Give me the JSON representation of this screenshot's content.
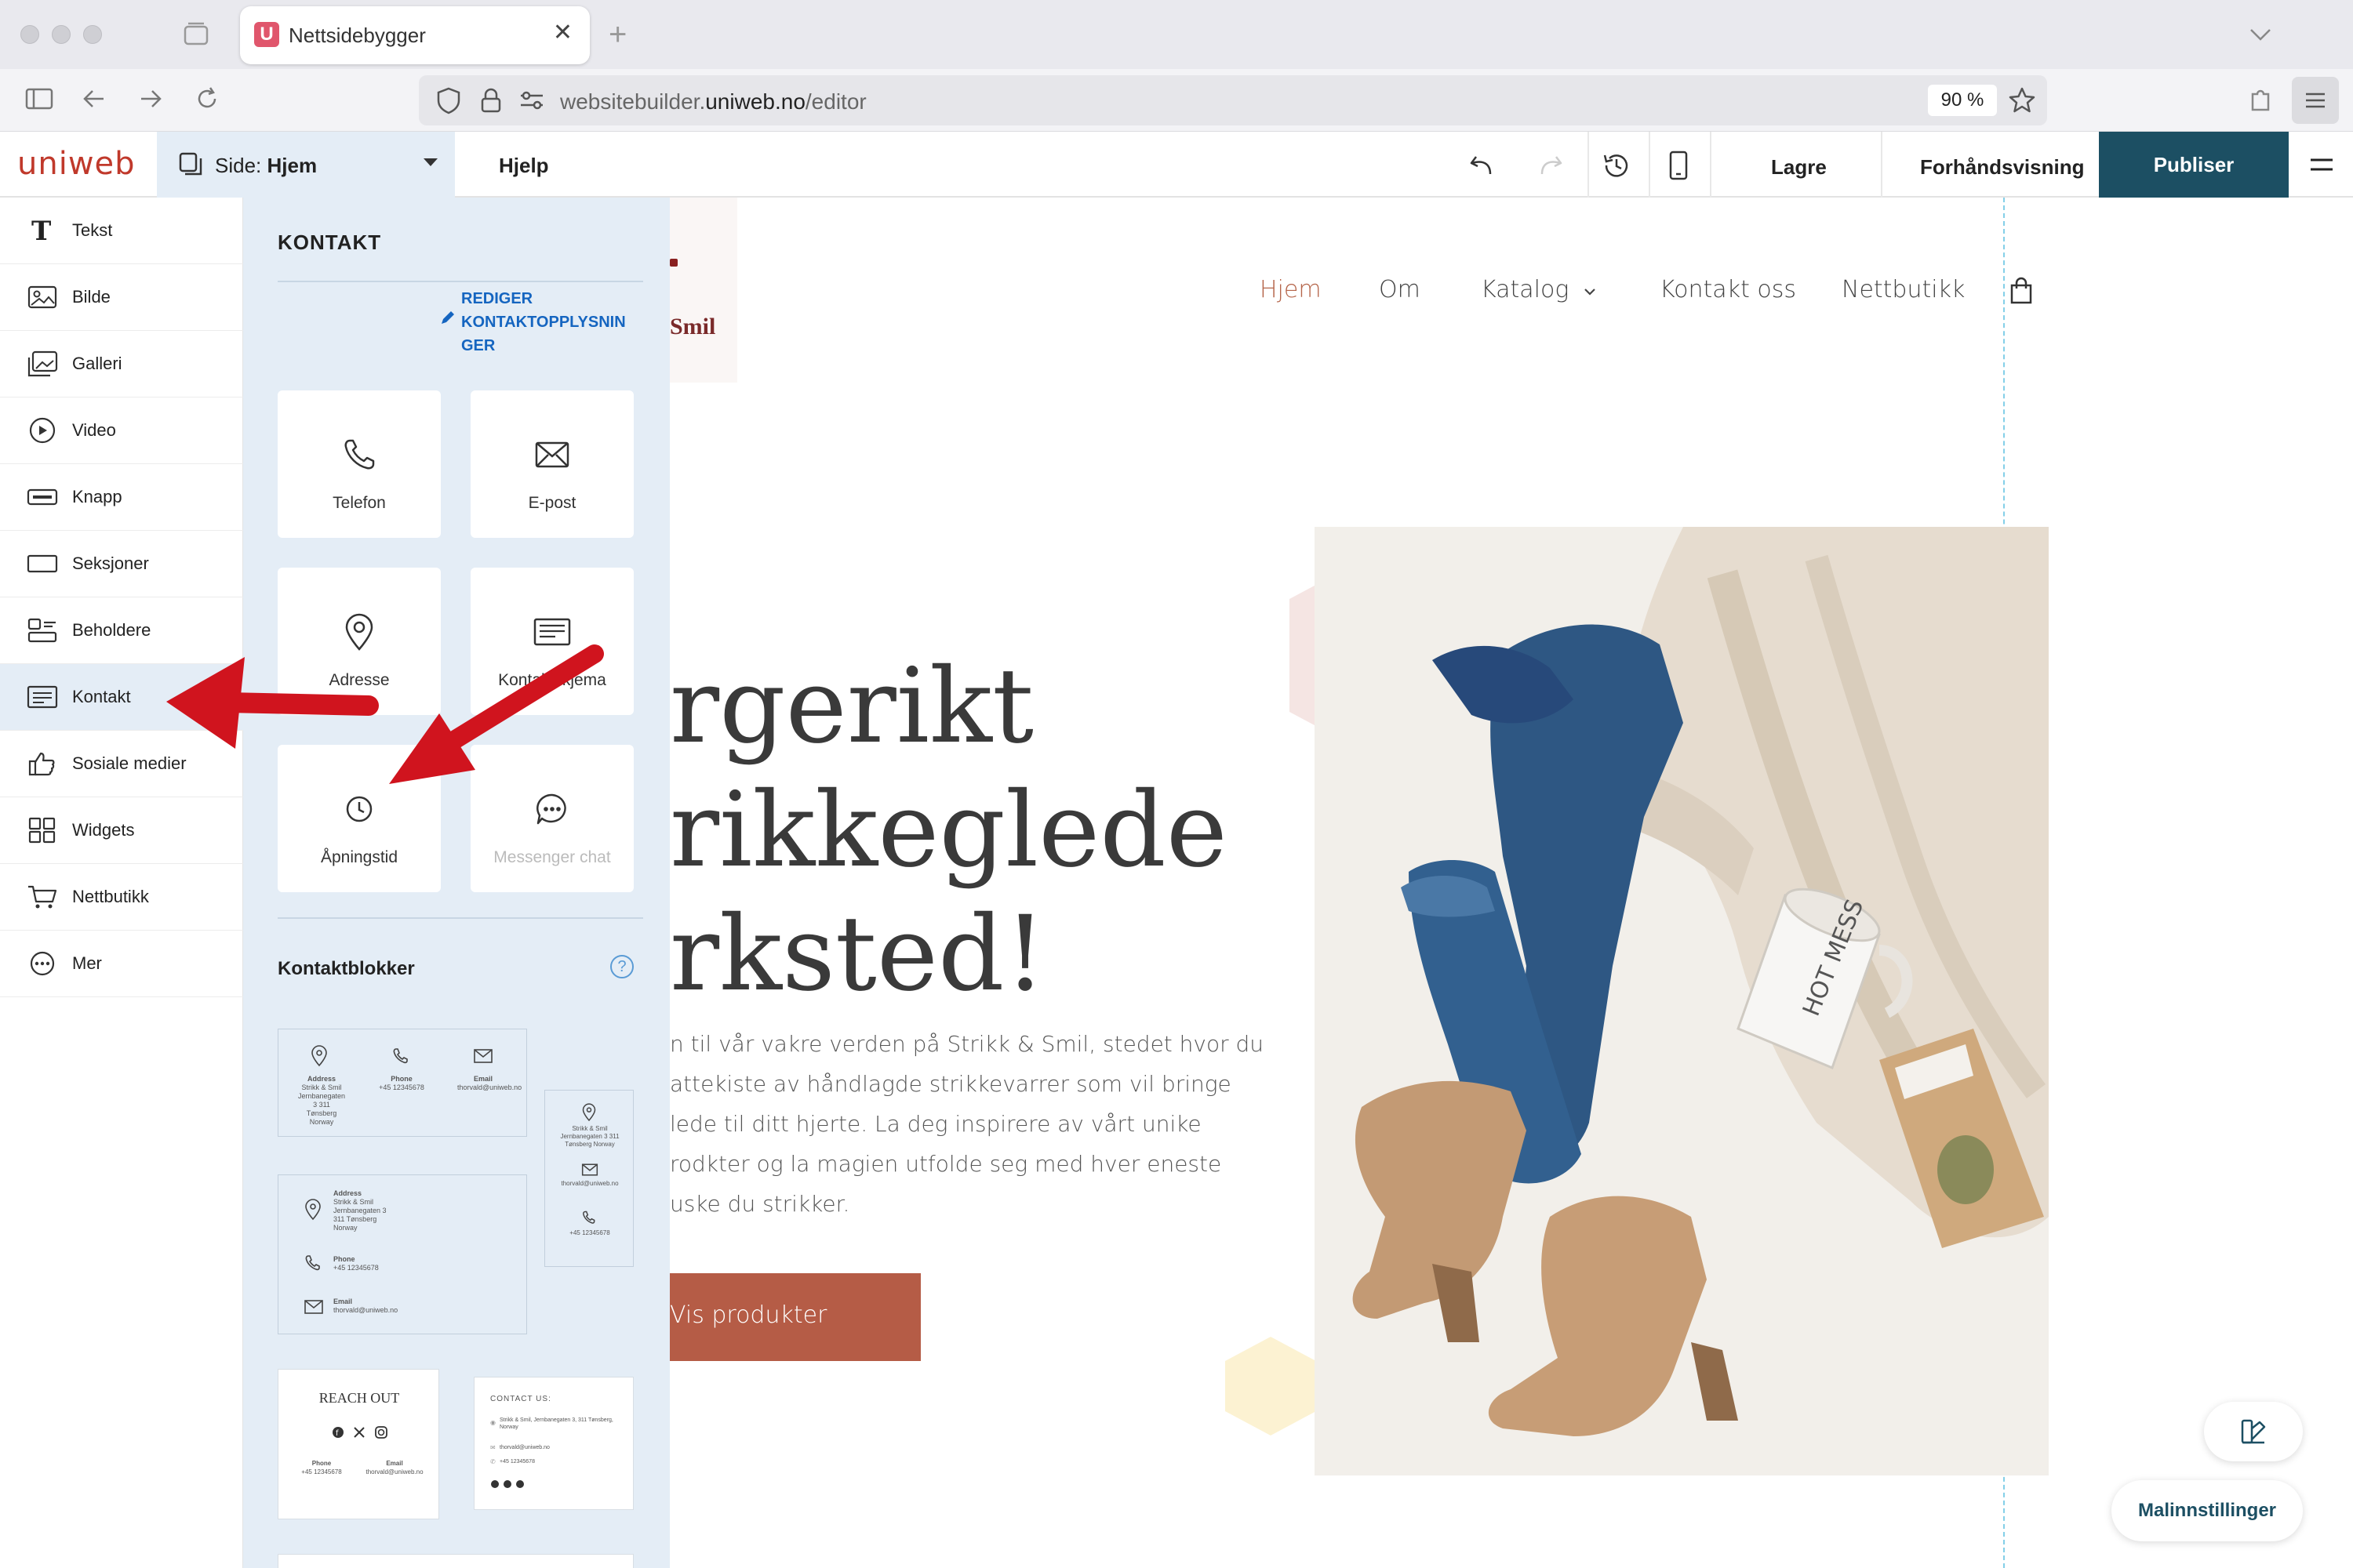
{
  "browser": {
    "tab_title": "Nettsidebygger",
    "tab_favicon": "U",
    "url_prefix": "websitebuilder.",
    "url_domain": "uniweb.no",
    "url_path": "/editor",
    "zoom": "90 %"
  },
  "toolbar": {
    "logo": "uniweb",
    "page_prefix": "Side: ",
    "page_name": "Hjem",
    "help": "Hjelp",
    "save": "Lagre",
    "preview": "Forhåndsvisning",
    "publish": "Publiser"
  },
  "sidebar": {
    "items": [
      {
        "label": "Tekst",
        "icon": "text-icon"
      },
      {
        "label": "Bilde",
        "icon": "image-icon"
      },
      {
        "label": "Galleri",
        "icon": "gallery-icon"
      },
      {
        "label": "Video",
        "icon": "video-icon"
      },
      {
        "label": "Knapp",
        "icon": "button-icon"
      },
      {
        "label": "Seksjoner",
        "icon": "sections-icon"
      },
      {
        "label": "Beholdere",
        "icon": "containers-icon"
      },
      {
        "label": "Kontakt",
        "icon": "contact-icon",
        "active": true
      },
      {
        "label": "Sosiale medier",
        "icon": "thumbs-up-icon"
      },
      {
        "label": "Widgets",
        "icon": "widgets-icon"
      },
      {
        "label": "Nettbutikk",
        "icon": "cart-icon"
      },
      {
        "label": "Mer",
        "icon": "more-icon"
      }
    ]
  },
  "panel": {
    "title": "KONTAKT",
    "edit_line1": "REDIGER",
    "edit_line2": "KONTAKTOPPLYSNIN",
    "edit_line3": "GER",
    "tiles": [
      {
        "label": "Telefon",
        "icon": "phone-icon"
      },
      {
        "label": "E-post",
        "icon": "email-icon"
      },
      {
        "label": "Adresse",
        "icon": "location-icon"
      },
      {
        "label": "Kontaktskjema",
        "icon": "form-icon"
      },
      {
        "label": "Åpningstid",
        "icon": "clock-icon"
      },
      {
        "label": "Messenger chat",
        "icon": "chat-icon",
        "disabled": true
      }
    ],
    "blocks_title": "Kontaktblokker",
    "blocks_help": "?",
    "block1": {
      "address_label": "Address",
      "address_text": "Strikk & Smil Jernbanegaten 3 311 Tønsberg Norway",
      "phone_label": "Phone",
      "phone_text": "+45 12345678",
      "email_label": "Email",
      "email_text": "thorvald@uniweb.no"
    },
    "block2": {
      "address_label": "Address",
      "address_line1": "Strikk & Smil",
      "address_line2": "Jernbanegaten 3",
      "address_line3": "311 Tønsberg",
      "address_line4": "Norway",
      "phone_label": "Phone",
      "phone_text": "+45 12345678",
      "email_label": "Email",
      "email_text": "thorvald@uniweb.no"
    },
    "block3": {
      "address_text": "Strikk & Smil Jernbanegaten 3 311 Tønsberg Norway",
      "email_text": "thorvald@uniweb.no",
      "phone_text": "+45 12345678"
    },
    "block4": {
      "title": "REACH OUT",
      "phone_label": "Phone",
      "phone_text": "+45 12345678",
      "email_label": "Email",
      "email_text": "thorvald@uniweb.no"
    },
    "block5": {
      "title": "CONTACT US:",
      "address_text": "Strikk & Smil, Jernbanegaten 3, 311 Tønsberg, Norway",
      "email_text": "thorvald@uniweb.no",
      "phone_text": "+45 12345678"
    }
  },
  "site": {
    "logo_text": "Smil",
    "nav": [
      "Hjem",
      "Om",
      "Katalog",
      "Kontakt oss",
      "Nettbutikk"
    ],
    "hero_title": "rgerikt\nrikkeglede\nrksted!",
    "hero_body": "n til vår vakre verden på Strikk & Smil, stedet hvor du\nattekiste av håndlagde strikkevarrer som vil bringe\nlede til ditt hjerte. La deg inspirere av vårt unike\nrodkter og la magien utfolde seg med hver eneste\nuske du strikker.",
    "hero_button": "Vis produkter",
    "mug_text": "HOT MESS"
  },
  "floating": {
    "template_settings": "Malinnstillinger"
  },
  "colors": {
    "brand_red": "#c0392b",
    "publish_bg": "#1c4f63",
    "panel_bg": "#e4edf6",
    "link_blue": "#1565c0",
    "hero_button": "#b55c46",
    "nav_active": "#b5654a",
    "arrow_red": "#d0141e"
  }
}
